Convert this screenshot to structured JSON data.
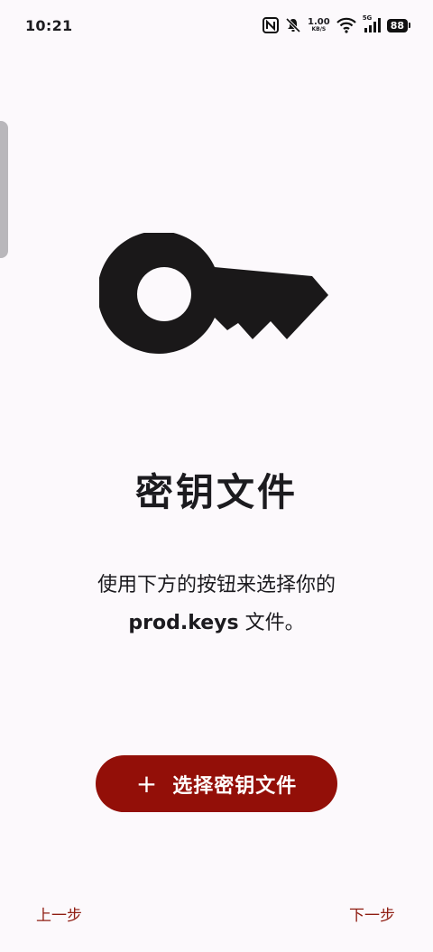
{
  "status_bar": {
    "time": "10:21",
    "net_speed_value": "1.00",
    "net_speed_unit": "KB/S",
    "network_type": "5G",
    "battery": "88"
  },
  "main": {
    "icon": "key-icon",
    "title": "密钥文件",
    "description_line1": "使用下方的按钮来选择你的",
    "description_bold": "prod.keys",
    "description_rest": " 文件。",
    "select_button_icon": "+",
    "select_button_label": "选择密钥文件"
  },
  "footer": {
    "prev_label": "上一步",
    "next_label": "下一步"
  },
  "colors": {
    "accent": "#930f08",
    "link": "#8f1d12",
    "background": "#fcf9fc"
  }
}
